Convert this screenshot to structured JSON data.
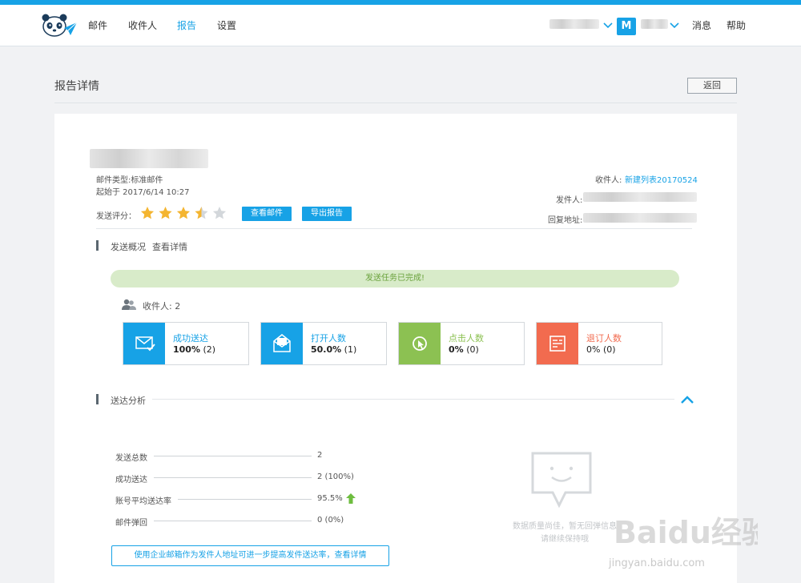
{
  "nav": {
    "mail": "邮件",
    "recipients": "收件人",
    "reports": "报告",
    "settings": "设置"
  },
  "header": {
    "avatar_letter": "M",
    "messages": "消息",
    "help": "帮助"
  },
  "page": {
    "title": "报告详情",
    "back_label": "返回"
  },
  "report": {
    "mail_type": "邮件类型:标准邮件",
    "start_time": "起始于 2017/6/14 10:27",
    "rating_label": "发送评分：",
    "rating": 3.5,
    "rating_max": 5,
    "view_mail_label": "查看邮件",
    "export_label": "导出报告",
    "recipients_label": "收件人:",
    "recipients_value": "新建列表20170524",
    "sender_label": "发件人:",
    "reply_label": "回复地址:"
  },
  "overview": {
    "section_title": "发送概况",
    "details_link": "查看详情",
    "status_text": "发送任务已完成!",
    "recipients_count_label": "收件人: 2",
    "stats": [
      {
        "label": "成功送达",
        "value": "100%",
        "count": "(2)",
        "color": "#17a2e6"
      },
      {
        "label": "打开人数",
        "value": "50.0%",
        "count": "(1)",
        "color": "#17a2e6"
      },
      {
        "label": "点击人数",
        "value": "0%",
        "count": "(0)",
        "color": "#8cc152"
      },
      {
        "label": "退订人数",
        "value": "0%",
        "count": "(0)",
        "color": "#f26b4f"
      }
    ]
  },
  "analysis": {
    "section_title": "送达分析",
    "rows": [
      {
        "label": "发送总数",
        "value": "2"
      },
      {
        "label": "成功送达",
        "value": "2 (100%)"
      },
      {
        "label": "账号平均送达率",
        "value": "95.5%"
      },
      {
        "label": "邮件弹回",
        "value": "0 (0%)"
      }
    ],
    "tip_button": "使用企业邮箱作为发件人地址可进一步提高发件送达率，查看详情",
    "empty_line1": "数据质量尚佳，暂无回弹信息",
    "empty_line2": "请继续保持哦"
  },
  "watermark": {
    "brand": "Baidu经验",
    "url": "jingyan.baidu.com"
  }
}
